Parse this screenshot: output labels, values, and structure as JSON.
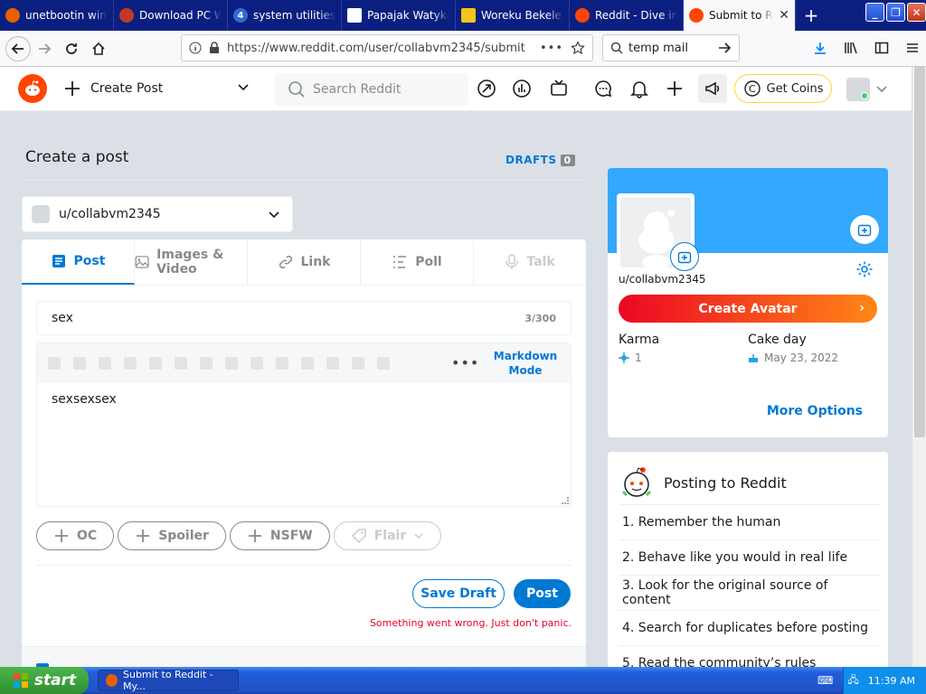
{
  "browser": {
    "tabs": [
      {
        "title": "unetbootin winxp",
        "favicon_color": "#e66000"
      },
      {
        "title": "Download PC Wizard",
        "favicon_color": "#c0392b"
      },
      {
        "title": "system utilities, a",
        "favicon_color": "#2b6cd8"
      },
      {
        "title": "Papajak Watykan",
        "favicon_color": "#333333"
      },
      {
        "title": "Woreku Bekele - I",
        "favicon_color": "#f5c518"
      },
      {
        "title": "Reddit - Dive into",
        "favicon_color": "#ff4500"
      },
      {
        "title": "Submit to Reddit",
        "favicon_color": "#ff4500"
      }
    ],
    "url": "https://www.reddit.com/user/collabvm2345/submit",
    "search_value": "temp mail"
  },
  "reddit_header": {
    "create_post_label": "Create Post",
    "search_placeholder": "Search Reddit",
    "get_coins_label": "Get Coins"
  },
  "create_post": {
    "title": "Create a post",
    "drafts_label": "DRAFTS",
    "drafts_count": "0",
    "community": "u/collabvm2345",
    "tabs": [
      {
        "label": "Post",
        "icon": "post-icon"
      },
      {
        "label": "Images & Video",
        "icon": "image-icon"
      },
      {
        "label": "Link",
        "icon": "link-icon"
      },
      {
        "label": "Poll",
        "icon": "poll-icon"
      },
      {
        "label": "Talk",
        "icon": "mic-icon"
      }
    ],
    "title_value": "sex",
    "title_counter": "3/300",
    "markdown_label_1": "Markdown",
    "markdown_label_2": "Mode",
    "body_value": "sexsexsex",
    "tags": [
      "OC",
      "Spoiler",
      "NSFW",
      "Flair"
    ],
    "save_draft_label": "Save Draft",
    "post_label": "Post",
    "error_message": "Something went wrong. Just don't panic."
  },
  "profile": {
    "username": "u/collabvm2345",
    "create_avatar_label": "Create Avatar",
    "karma_label": "Karma",
    "karma_value": "1",
    "cake_label": "Cake day",
    "cake_value": "May 23, 2022",
    "more_options_label": "More Options"
  },
  "rules": {
    "title": "Posting to Reddit",
    "items": [
      "1. Remember the human",
      "2. Behave like you would in real life",
      "3. Look for the original source of content",
      "4. Search for duplicates before posting",
      "5. Read the community’s rules"
    ]
  },
  "taskbar": {
    "start_label": "start",
    "task_label": "Submit to Reddit - My...",
    "clock": "11:39 AM"
  }
}
